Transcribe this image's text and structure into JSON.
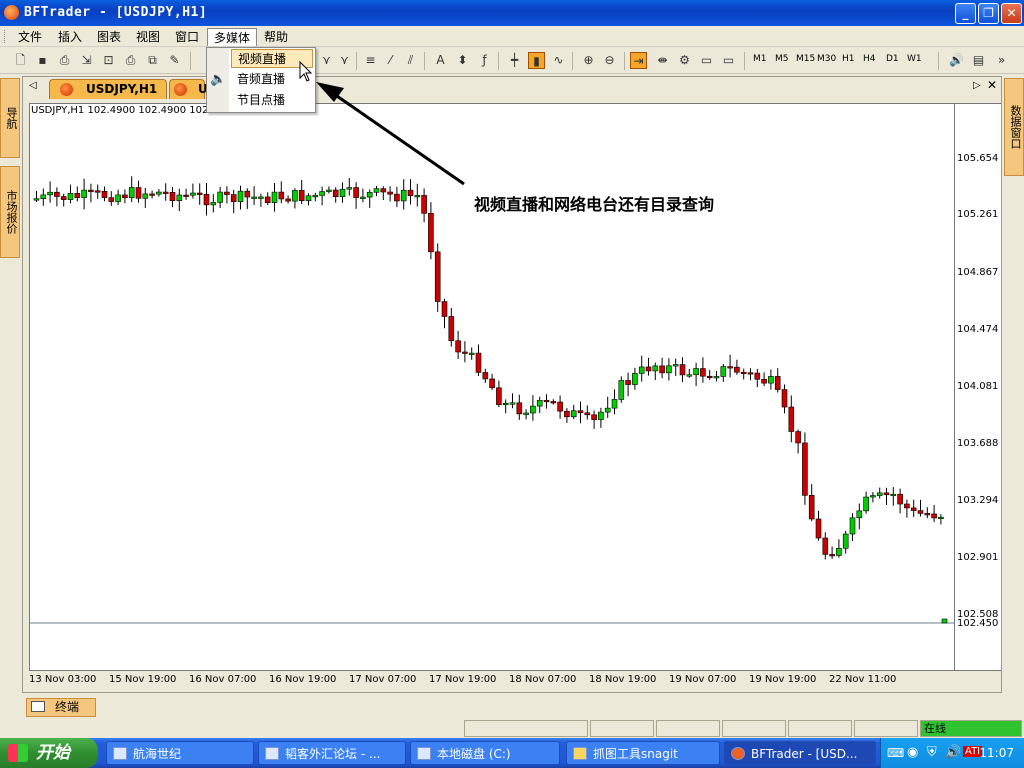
{
  "window": {
    "title": "BFTrader - [USDJPY,H1]",
    "min": "_",
    "max": "❐",
    "close": "✕"
  },
  "menu": [
    "文件",
    "插入",
    "图表",
    "视图",
    "窗口",
    "多媒体",
    "帮助"
  ],
  "dropdown": {
    "items": [
      "视频直播",
      "音频直播",
      "节目点播"
    ]
  },
  "toolbar": {
    "text_tool": "A",
    "timeframes": [
      "M1",
      "M5",
      "M15",
      "M30",
      "H1",
      "H4",
      "D1",
      "W1"
    ]
  },
  "side_left": {
    "nav": "导航",
    "quotes": "市场报价"
  },
  "side_right": {
    "data": "数据窗口"
  },
  "chart_tabs": {
    "active": "USDJPY,H1",
    "second": "U"
  },
  "chart": {
    "header": "USDJPY,H1 102.4900 102.4900 102.4900 102.4900",
    "current_price": "102.450",
    "price_ticks": [
      "105.654",
      "105.261",
      "104.867",
      "104.474",
      "104.081",
      "103.688",
      "103.294",
      "102.901",
      "102.508"
    ],
    "time_ticks": [
      "13 Nov 03:00",
      "15 Nov 19:00",
      "16 Nov 07:00",
      "16 Nov 19:00",
      "17 Nov 07:00",
      "17 Nov 19:00",
      "18 Nov 07:00",
      "18 Nov 19:00",
      "19 Nov 07:00",
      "19 Nov 19:00",
      "22 Nov 11:00"
    ],
    "bull_color": "#00cc00",
    "bear_color": "#cc0000"
  },
  "annotation": "视频直播和网络电台还有目录查询",
  "terminal": "终端",
  "status": {
    "online": "在线"
  },
  "taskbar": {
    "start": "开始",
    "tasks": [
      "航海世纪",
      "韬客外汇论坛 - ...",
      "本地磁盘 (C:)",
      "抓图工具snagit",
      "BFTrader - [USD..."
    ],
    "clock": "11:07"
  }
}
